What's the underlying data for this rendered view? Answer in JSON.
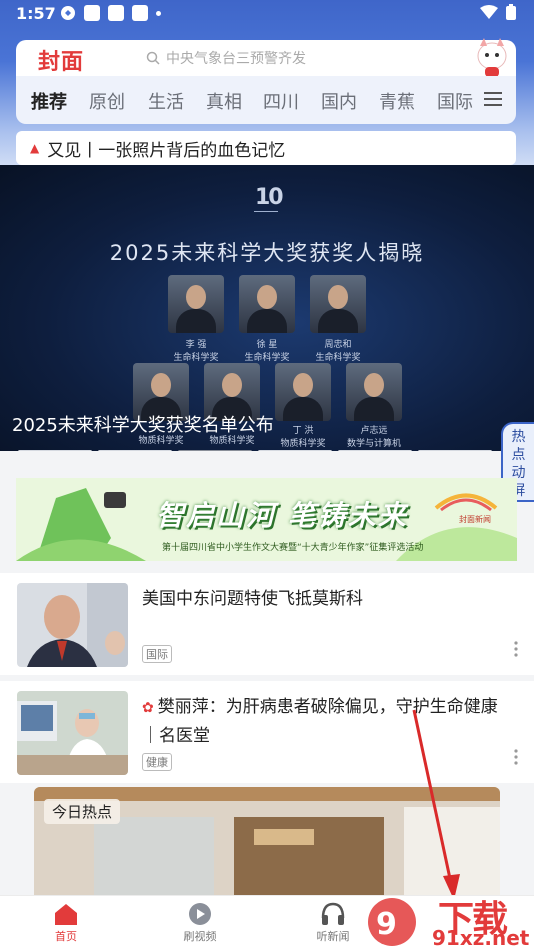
{
  "status_bar": {
    "time": "1:57"
  },
  "header": {
    "logo_text": "封面",
    "search_placeholder": "中央气象台三预警齐发"
  },
  "tabs": [
    {
      "label": "推荐",
      "active": true
    },
    {
      "label": "原创"
    },
    {
      "label": "生活"
    },
    {
      "label": "真相"
    },
    {
      "label": "四川"
    },
    {
      "label": "国内"
    },
    {
      "label": "青蕉"
    },
    {
      "label": "国际"
    }
  ],
  "pinned_headline": "又见丨一张照片背后的血色记忆",
  "banner": {
    "top_mark": "10",
    "title": "2025未来科学大奖获奖人揭晓",
    "caption": "2025未来科学大奖获奖名单公布",
    "people_row1": [
      {
        "name": "李 强",
        "role": "生命科学奖"
      },
      {
        "name": "徐 星",
        "role": "生命科学奖"
      },
      {
        "name": "周忠和",
        "role": "生命科学奖"
      }
    ],
    "people_row2": [
      {
        "name": "",
        "role": "物质科学奖"
      },
      {
        "name": "",
        "role": "物质科学奖"
      },
      {
        "name": "丁 洪",
        "role": "物质科学奖"
      },
      {
        "name": "卢志远",
        "role": "数学与计算机科学奖"
      }
    ],
    "indicator_count": 6,
    "active_indicator": 2
  },
  "side_tab": "热点动屏",
  "ad": {
    "title": "智启山河 笔铸未来",
    "subtitle": "第十届四川省中小学生作文大赛暨“十大青少年作家”征集评选活动",
    "logo": "封面新闻"
  },
  "news": [
    {
      "title": "美国中东问题特使飞抵莫斯科",
      "tag": "国际"
    },
    {
      "title": "樊丽萍：为肝病患者破除偏见，守护生命健康｜名医堂",
      "tag": "健康"
    }
  ],
  "hot_card_label": "今日热点",
  "bottom_nav": [
    {
      "label": "首页",
      "icon": "home-icon",
      "active": true
    },
    {
      "label": "刷视频",
      "icon": "play-icon"
    },
    {
      "label": "听新闻",
      "icon": "headphones-icon"
    }
  ],
  "watermark": {
    "text": "下载站",
    "url": "91xz.net"
  },
  "colors": {
    "accent": "#e23b3b",
    "header_blue": "#4a74d6",
    "banner_dark": "#0e1e3e"
  }
}
